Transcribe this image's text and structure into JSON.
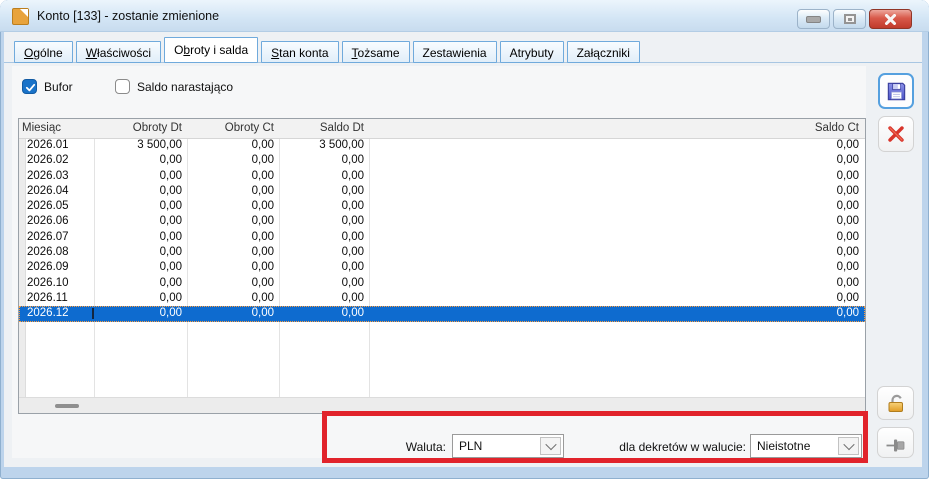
{
  "window": {
    "title": "Konto [133] - zostanie zmienione",
    "icon": "document-icon",
    "controls": [
      "minimize",
      "maximize",
      "close"
    ]
  },
  "tabs": [
    {
      "pre": "",
      "key": "O",
      "post": "gólne"
    },
    {
      "pre": "",
      "key": "W",
      "post": "łaściwości"
    },
    {
      "pre": "O",
      "key": "b",
      "post": "roty i salda"
    },
    {
      "pre": "",
      "key": "S",
      "post": "tan konta"
    },
    {
      "pre": "",
      "key": "T",
      "post": "ożsame"
    },
    {
      "pre": "Zestawienia",
      "key": "",
      "post": ""
    },
    {
      "pre": "Atrybuty",
      "key": "",
      "post": ""
    },
    {
      "pre": "Załączniki",
      "key": "",
      "post": ""
    }
  ],
  "active_tab": "Obroty i salda",
  "filters": {
    "bufor_label": "Bufor",
    "bufor_checked": true,
    "saldo_label": "Saldo narastająco",
    "saldo_checked": false
  },
  "table": {
    "columns": [
      "Miesiąc",
      "Obroty Dt",
      "Obroty Ct",
      "Saldo Dt",
      "Saldo Ct"
    ],
    "selected_month": "2026.12",
    "rows": [
      {
        "month": "2026.01",
        "obroty_dt": "3 500,00",
        "obroty_ct": "0,00",
        "saldo_dt": "3 500,00",
        "saldo_ct": "0,00"
      },
      {
        "month": "2026.02",
        "obroty_dt": "0,00",
        "obroty_ct": "0,00",
        "saldo_dt": "0,00",
        "saldo_ct": "0,00"
      },
      {
        "month": "2026.03",
        "obroty_dt": "0,00",
        "obroty_ct": "0,00",
        "saldo_dt": "0,00",
        "saldo_ct": "0,00"
      },
      {
        "month": "2026.04",
        "obroty_dt": "0,00",
        "obroty_ct": "0,00",
        "saldo_dt": "0,00",
        "saldo_ct": "0,00"
      },
      {
        "month": "2026.05",
        "obroty_dt": "0,00",
        "obroty_ct": "0,00",
        "saldo_dt": "0,00",
        "saldo_ct": "0,00"
      },
      {
        "month": "2026.06",
        "obroty_dt": "0,00",
        "obroty_ct": "0,00",
        "saldo_dt": "0,00",
        "saldo_ct": "0,00"
      },
      {
        "month": "2026.07",
        "obroty_dt": "0,00",
        "obroty_ct": "0,00",
        "saldo_dt": "0,00",
        "saldo_ct": "0,00"
      },
      {
        "month": "2026.08",
        "obroty_dt": "0,00",
        "obroty_ct": "0,00",
        "saldo_dt": "0,00",
        "saldo_ct": "0,00"
      },
      {
        "month": "2026.09",
        "obroty_dt": "0,00",
        "obroty_ct": "0,00",
        "saldo_dt": "0,00",
        "saldo_ct": "0,00"
      },
      {
        "month": "2026.10",
        "obroty_dt": "0,00",
        "obroty_ct": "0,00",
        "saldo_dt": "0,00",
        "saldo_ct": "0,00"
      },
      {
        "month": "2026.11",
        "obroty_dt": "0,00",
        "obroty_ct": "0,00",
        "saldo_dt": "0,00",
        "saldo_ct": "0,00"
      },
      {
        "month": "2026.12",
        "obroty_dt": "0,00",
        "obroty_ct": "0,00",
        "saldo_dt": "0,00",
        "saldo_ct": "0,00"
      }
    ]
  },
  "footer": {
    "currency_label": "Waluta:",
    "currency_value": "PLN",
    "decree_label": "dla dekretów w walucie:",
    "decree_value": "Nieistotne"
  },
  "side_buttons": {
    "save": "floppy-disk-icon",
    "cancel": "red-x-icon",
    "lock": "open-padlock-icon",
    "pin": "pin-icon"
  },
  "colors": {
    "selection_blue": "#0e6bcf",
    "checkbox_blue": "#1a73c9",
    "annotation_red": "#e1232b",
    "tab_border_blue": "#70aadc"
  }
}
